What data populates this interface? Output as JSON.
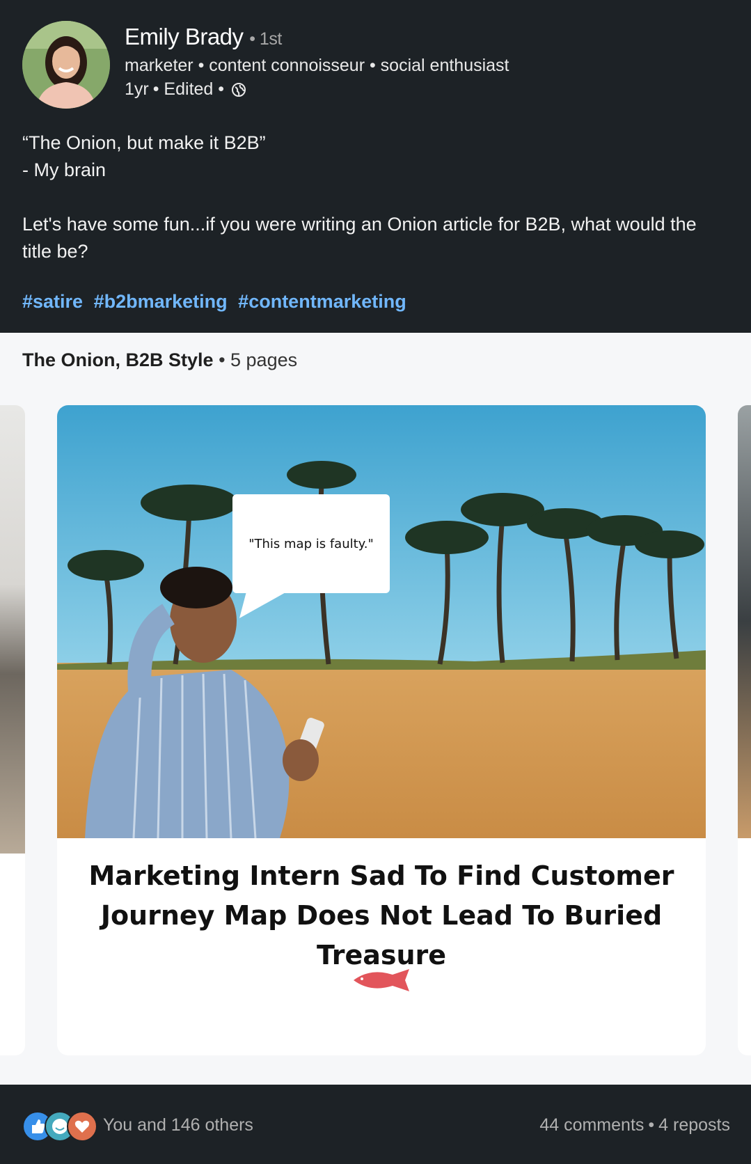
{
  "post": {
    "author": {
      "name": "Emily Brady",
      "degree": "• 1st",
      "headline": "marketer • content connoisseur • social enthusiast",
      "time": "1yr",
      "edited": "• Edited •"
    },
    "text": {
      "line1": "“The Onion, but make it B2B”",
      "line2": "- My brain",
      "line3": "Let's have some fun...if you were writing an Onion article for B2B, what would the title be?"
    },
    "hashtags": [
      "#satire",
      "#b2bmarketing",
      "#contentmarketing"
    ]
  },
  "document": {
    "title": "The Onion, B2B Style",
    "pages": "• 5 pages",
    "slide": {
      "bubble_text": "\"This map is faulty.\"",
      "headline": "Marketing Intern Sad To Find Customer Journey Map Does Not Lead To Buried Treasure",
      "brand": "SWEET FISH"
    }
  },
  "social": {
    "reactions_text": "You and 146 others",
    "comments": "44 comments",
    "separator": "•",
    "reposts": "4 reposts",
    "reaction_icons": [
      "like-icon",
      "funny-icon",
      "love-icon"
    ]
  },
  "colors": {
    "background": "#1d2226",
    "hashtag": "#71b7fb",
    "like": "#378fe9",
    "funny": "#44a9bd",
    "love": "#df704d"
  }
}
